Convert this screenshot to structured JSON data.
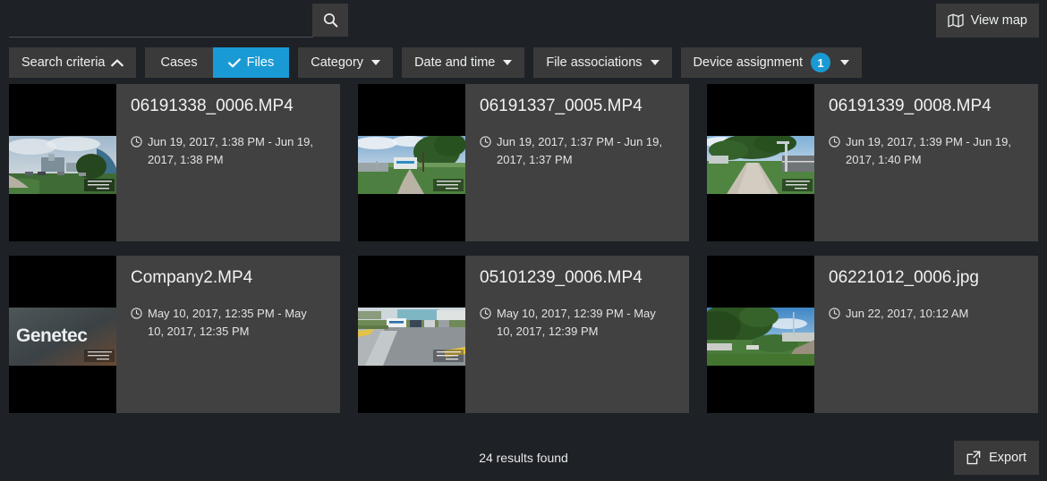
{
  "colors": {
    "page_bg": "#1e2227",
    "card_bg": "#414141",
    "button_bg": "#3a3a3a",
    "accent": "#1a9ad4",
    "text": "#e8e8e8"
  },
  "search": {
    "value": "",
    "placeholder": "",
    "search_icon": "search-icon",
    "view_map_label": "View map",
    "view_map_icon": "map-icon"
  },
  "filters": {
    "search_criteria": {
      "label": "Search criteria",
      "icon": "chevron-up-icon"
    },
    "cases": {
      "label": "Cases",
      "active": false
    },
    "files": {
      "label": "Files",
      "active": true,
      "icon": "check-icon"
    },
    "category": {
      "label": "Category",
      "icon": "caret-down-icon"
    },
    "date_and_time": {
      "label": "Date and time",
      "icon": "caret-down-icon"
    },
    "file_associations": {
      "label": "File associations",
      "icon": "caret-down-icon"
    },
    "device_assignment": {
      "label": "Device assignment",
      "badge": "1",
      "icon": "caret-down-icon"
    }
  },
  "results": [
    {
      "title": "06191338_0006.MP4",
      "time": "Jun 19, 2017, 1:38 PM - Jun 19, 2017, 1:38 PM",
      "thumb": "building-campus-sky"
    },
    {
      "title": "06191337_0005.MP4",
      "time": "Jun 19, 2017, 1:37 PM - Jun 19, 2017, 1:37 PM",
      "thumb": "sign-path-trees"
    },
    {
      "title": "06191339_0008.MP4",
      "time": "Jun 19, 2017, 1:39 PM - Jun 19, 2017, 1:40 PM",
      "thumb": "sidewalk-lamppost"
    },
    {
      "title": "Company2.MP4",
      "time": "May 10, 2017, 12:35 PM - May 10, 2017, 12:35 PM",
      "thumb": "genetec-logo"
    },
    {
      "title": "05101239_0006.MP4",
      "time": "May 10, 2017, 12:39 PM - May 10, 2017, 12:39 PM",
      "thumb": "parking-lot-road"
    },
    {
      "title": "06221012_0006.jpg",
      "time": "Jun 22, 2017, 10:12 AM",
      "thumb": "tree-road-sky"
    }
  ],
  "footer": {
    "results_count": "24 results found",
    "export_label": "Export",
    "export_icon": "external-link-icon"
  }
}
